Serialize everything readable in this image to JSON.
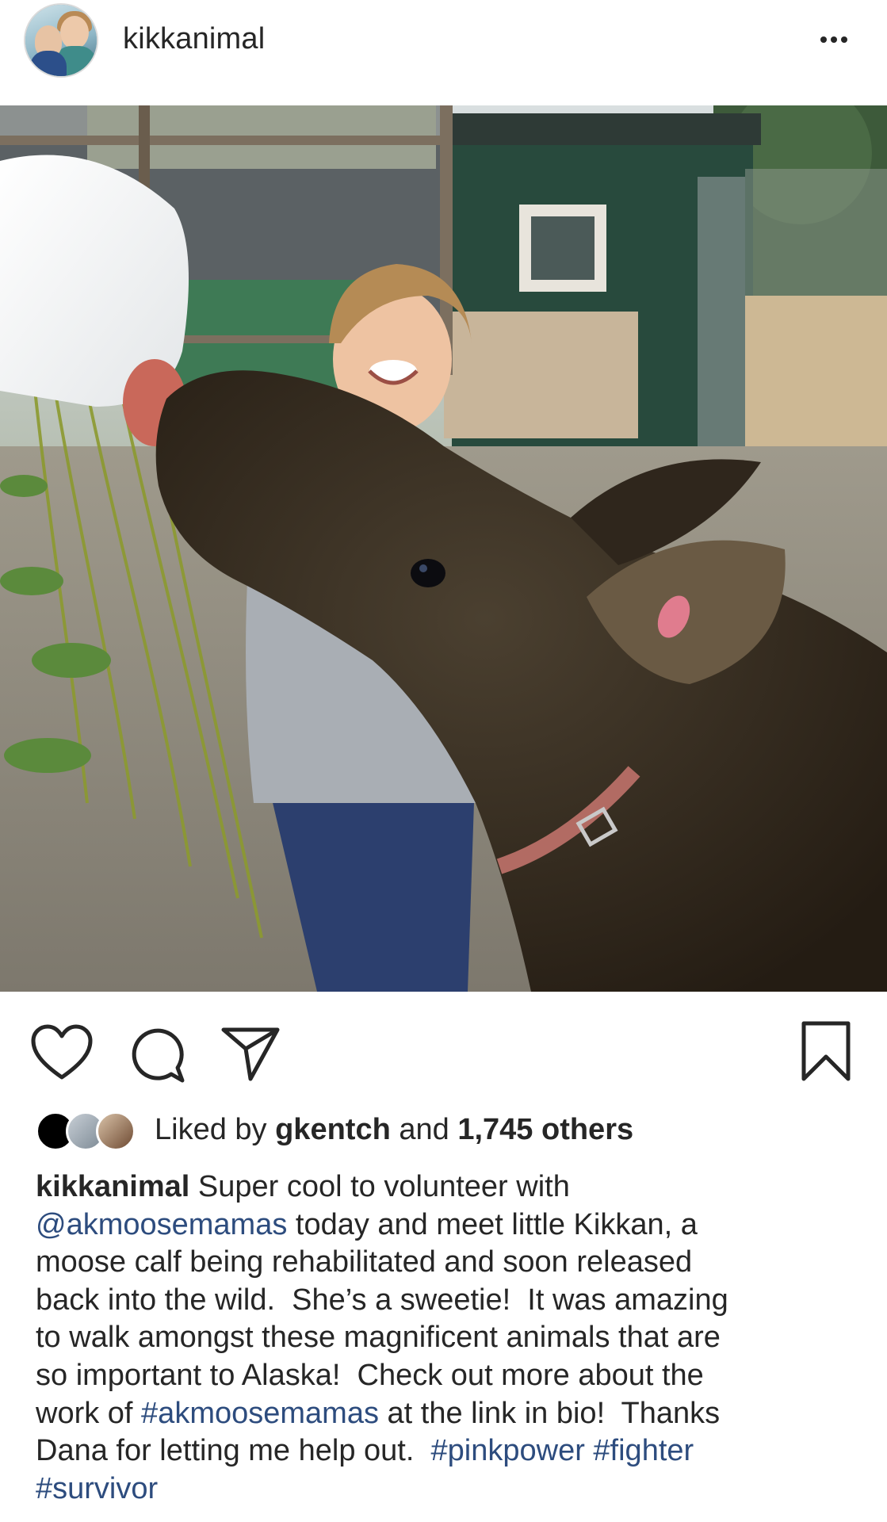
{
  "post": {
    "username": "kikkanimal",
    "more_icon": "more-horizontal-icon"
  },
  "actions": {
    "like_icon": "heart-icon",
    "comment_icon": "comment-icon",
    "share_icon": "paper-plane-icon",
    "save_icon": "bookmark-icon"
  },
  "likes": {
    "prefix": "Liked by ",
    "user": "gkentch",
    "mid": " and ",
    "count": "1,745 others"
  },
  "caption": {
    "username": "kikkanimal",
    "segments": [
      {
        "type": "text",
        "text": " Super cool to volunteer with\n"
      },
      {
        "type": "tag",
        "text": "@akmoosemamas"
      },
      {
        "type": "text",
        "text": " today and meet little Kikkan, a\nmoose calf being rehabilitated and soon released\nback into the wild.  She’s a sweetie!  It was amazing\nto walk amongst these magnificent animals that are\nso important to Alaska!  Check out more about the\nwork of "
      },
      {
        "type": "tag",
        "text": "#akmoosemamas"
      },
      {
        "type": "text",
        "text": " at the link in bio!  Thanks\nDana for letting me help out.  "
      },
      {
        "type": "tag",
        "text": "#pinkpower"
      },
      {
        "type": "text",
        "text": " "
      },
      {
        "type": "tag",
        "text": "#fighter"
      },
      {
        "type": "text",
        "text": "\n"
      },
      {
        "type": "tag",
        "text": "#survivor"
      }
    ]
  },
  "colors": {
    "text": "#262626",
    "link": "#2d4c7e",
    "background": "#ffffff"
  }
}
